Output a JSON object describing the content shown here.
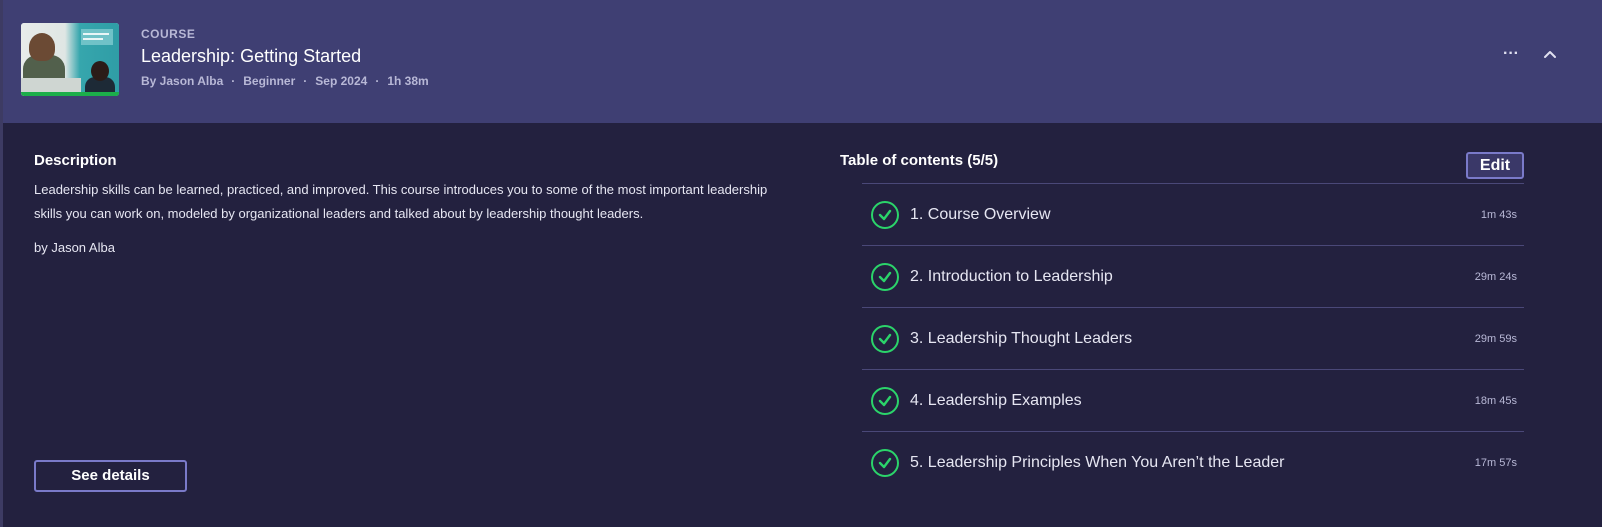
{
  "header": {
    "kicker": "COURSE",
    "title": "Leadership: Getting Started",
    "meta": [
      "By Jason Alba",
      "Beginner",
      "Sep 2024",
      "1h 38m"
    ],
    "separator": "·",
    "more_label": "···"
  },
  "description": {
    "heading": "Description",
    "text": "Leadership skills can be learned, practiced, and improved. This course introduces you to some of the most important leadership skills you can work on, modeled by organizational leaders and talked about by leadership thought leaders.",
    "author": "by Jason Alba",
    "details_button": "See details"
  },
  "toc": {
    "heading": "Table of contents (5/5)",
    "edit_button": "Edit",
    "items": [
      {
        "title": "1. Course Overview",
        "duration": "1m 43s",
        "completed": true
      },
      {
        "title": "2. Introduction to Leadership",
        "duration": "29m 24s",
        "completed": true
      },
      {
        "title": "3. Leadership Thought Leaders",
        "duration": "29m 59s",
        "completed": true
      },
      {
        "title": "4. Leadership Examples",
        "duration": "18m 45s",
        "completed": true
      },
      {
        "title": "5. Leadership Principles When You Aren’t the Leader",
        "duration": "17m 57s",
        "completed": true
      }
    ]
  },
  "colors": {
    "header_bg": "#3f3f73",
    "page_bg": "#23213f",
    "accent_border": "#7a7ac9",
    "complete_green": "#2bd46a",
    "progress_green": "#1cae4a"
  },
  "icons": {
    "more": "more-horizontal-icon",
    "collapse": "chevron-up-icon",
    "complete": "check-circle-icon"
  }
}
